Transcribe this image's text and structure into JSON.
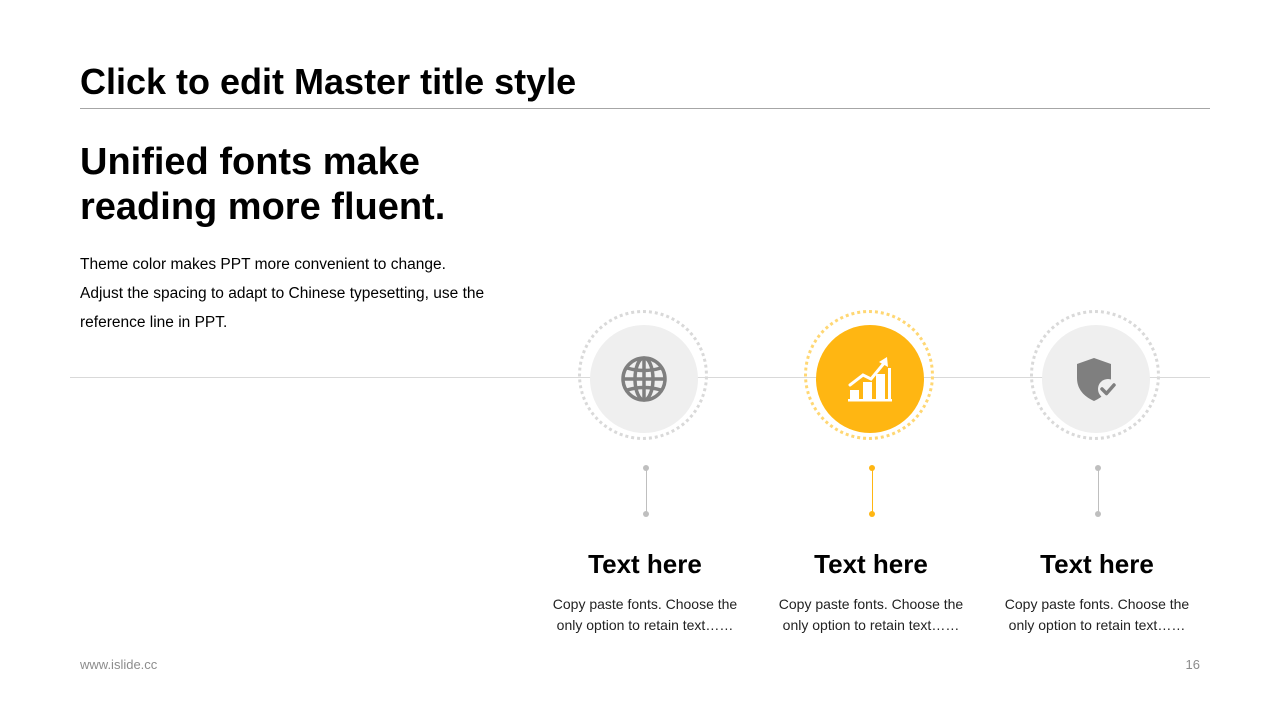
{
  "master_title": "Click to edit Master title style",
  "headline": "Unified fonts make reading more fluent.",
  "body_lines": [
    "Theme color makes PPT more convenient to change.",
    "Adjust the spacing to adapt to Chinese typesetting, use the reference line in PPT."
  ],
  "accent_color": "#ffb612",
  "neutral_color": "#efefef",
  "items": [
    {
      "icon": "globe-icon",
      "title": "Text here",
      "description": "Copy paste fonts. Choose the only option to retain text……",
      "active": false
    },
    {
      "icon": "growth-chart-icon",
      "title": "Text here",
      "description": "Copy paste fonts. Choose the only option to retain text……",
      "active": true
    },
    {
      "icon": "shield-check-icon",
      "title": "Text here",
      "description": "Copy paste fonts. Choose the only option to retain text……",
      "active": false
    }
  ],
  "footer": {
    "url": "www.islide.cc",
    "page_number": "16"
  }
}
